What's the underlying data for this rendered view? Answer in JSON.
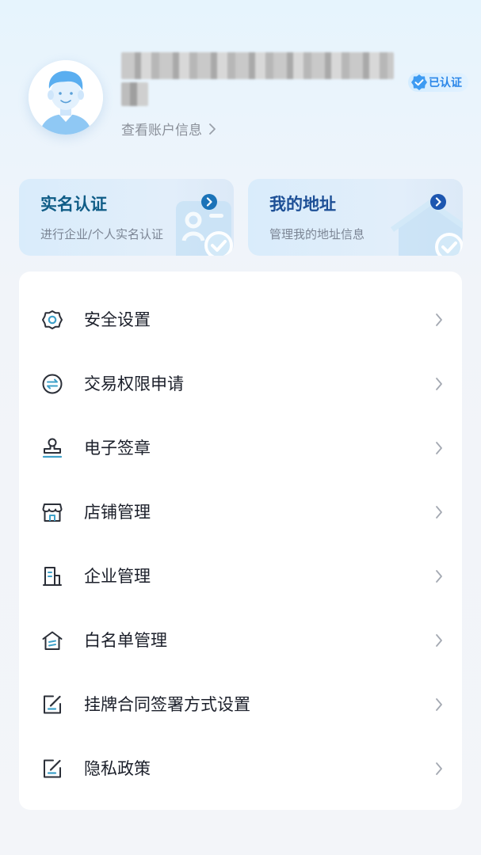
{
  "profile": {
    "verified_badge": "已认证",
    "account_link": "查看账户信息"
  },
  "cards": [
    {
      "title": "实名认证",
      "subtitle": "进行企业/个人实名认证"
    },
    {
      "title": "我的地址",
      "subtitle": "管理我的地址信息"
    }
  ],
  "menu": {
    "items": [
      {
        "label": "安全设置",
        "icon": "gear-icon"
      },
      {
        "label": "交易权限申请",
        "icon": "exchange-icon"
      },
      {
        "label": "电子签章",
        "icon": "stamp-icon"
      },
      {
        "label": "店铺管理",
        "icon": "store-icon"
      },
      {
        "label": "企业管理",
        "icon": "building-icon"
      },
      {
        "label": "白名单管理",
        "icon": "house-list-icon"
      },
      {
        "label": "挂牌合同签署方式设置",
        "icon": "edit-icon"
      },
      {
        "label": "隐私政策",
        "icon": "edit-icon"
      }
    ]
  },
  "colors": {
    "card_title_left": "#0f5c86",
    "card_title_right": "#1d4f96",
    "accent_blue": "#2a86e8",
    "icon_teal": "#3fa1c9",
    "text_primary": "#1b1f2a",
    "text_secondary": "#8a8f99"
  }
}
